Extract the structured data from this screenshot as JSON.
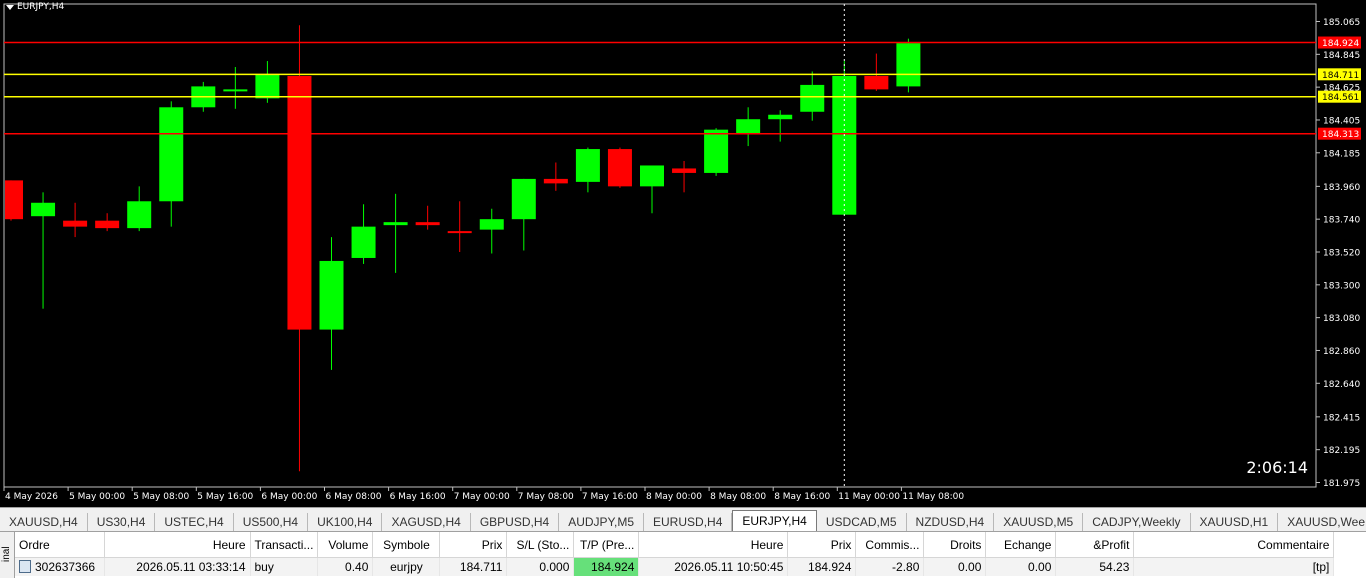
{
  "chart": {
    "symbol_label": "EURJPY,H4",
    "timer": "2:06:14",
    "y_axis_range": [
      181.975,
      185.065
    ],
    "x_labels": [
      "4 May 2026",
      "5 May 00:00",
      "5 May 08:00",
      "5 May 16:00",
      "6 May 00:00",
      "6 May 08:00",
      "6 May 16:00",
      "7 May 00:00",
      "7 May 08:00",
      "7 May 16:00",
      "8 May 00:00",
      "8 May 08:00",
      "8 May 16:00",
      "11 May 00:00",
      "11 May 08:00"
    ],
    "y_labels": [
      "185.065",
      "184.845",
      "184.625",
      "184.405",
      "184.185",
      "183.960",
      "183.740",
      "183.520",
      "183.300",
      "183.080",
      "182.860",
      "182.640",
      "182.415",
      "182.195",
      "181.975"
    ],
    "levels": [
      {
        "value": 184.924,
        "label": "184.924",
        "color": "#ff0000"
      },
      {
        "value": 184.711,
        "label": "184.711",
        "color": "#ffff00"
      },
      {
        "value": 184.561,
        "label": "184.561",
        "color": "#ffff00"
      },
      {
        "value": 184.313,
        "label": "184.313",
        "color": "#ff0000"
      }
    ],
    "bull_color": "#00ff00",
    "bear_color": "#ff0000",
    "candles": [
      {
        "o": 184.0,
        "h": 184.0,
        "l": 183.73,
        "c": 183.74
      },
      {
        "o": 183.76,
        "h": 183.92,
        "l": 183.14,
        "c": 183.85
      },
      {
        "o": 183.73,
        "h": 183.85,
        "l": 183.62,
        "c": 183.69
      },
      {
        "o": 183.73,
        "h": 183.78,
        "l": 183.66,
        "c": 183.68
      },
      {
        "o": 183.68,
        "h": 183.96,
        "l": 183.66,
        "c": 183.86
      },
      {
        "o": 183.86,
        "h": 184.53,
        "l": 183.69,
        "c": 184.49
      },
      {
        "o": 184.49,
        "h": 184.66,
        "l": 184.46,
        "c": 184.63
      },
      {
        "o": 184.6,
        "h": 184.76,
        "l": 184.48,
        "c": 184.61
      },
      {
        "o": 184.55,
        "h": 184.8,
        "l": 184.52,
        "c": 184.71
      },
      {
        "o": 184.7,
        "h": 185.04,
        "l": 182.05,
        "c": 183.0
      },
      {
        "o": 183.0,
        "h": 183.62,
        "l": 182.73,
        "c": 183.46
      },
      {
        "o": 183.48,
        "h": 183.84,
        "l": 183.44,
        "c": 183.69
      },
      {
        "o": 183.7,
        "h": 183.91,
        "l": 183.38,
        "c": 183.72
      },
      {
        "o": 183.72,
        "h": 183.83,
        "l": 183.67,
        "c": 183.7
      },
      {
        "o": 183.66,
        "h": 183.86,
        "l": 183.52,
        "c": 183.65
      },
      {
        "o": 183.67,
        "h": 183.81,
        "l": 183.51,
        "c": 183.74
      },
      {
        "o": 183.74,
        "h": 184.01,
        "l": 183.53,
        "c": 184.01
      },
      {
        "o": 184.01,
        "h": 184.12,
        "l": 183.93,
        "c": 183.98
      },
      {
        "o": 183.99,
        "h": 184.22,
        "l": 183.92,
        "c": 184.21
      },
      {
        "o": 184.21,
        "h": 184.22,
        "l": 183.95,
        "c": 183.96
      },
      {
        "o": 183.96,
        "h": 184.1,
        "l": 183.78,
        "c": 184.1
      },
      {
        "o": 184.08,
        "h": 184.13,
        "l": 183.92,
        "c": 184.05
      },
      {
        "o": 184.05,
        "h": 184.35,
        "l": 184.03,
        "c": 184.34
      },
      {
        "o": 184.31,
        "h": 184.49,
        "l": 184.23,
        "c": 184.41
      },
      {
        "o": 184.41,
        "h": 184.47,
        "l": 184.26,
        "c": 184.44
      },
      {
        "o": 184.46,
        "h": 184.73,
        "l": 184.4,
        "c": 184.64
      },
      {
        "o": 183.77,
        "h": 184.8,
        "l": 183.77,
        "c": 184.7
      },
      {
        "o": 184.7,
        "h": 184.85,
        "l": 184.6,
        "c": 184.61
      },
      {
        "o": 184.63,
        "h": 184.95,
        "l": 184.59,
        "c": 184.92
      }
    ]
  },
  "tabs": [
    "XAUUSD,H4",
    "US30,H4",
    "USTEC,H4",
    "US500,H4",
    "UK100,H4",
    "XAGUSD,H4",
    "GBPUSD,H4",
    "AUDJPY,M5",
    "EURUSD,H4",
    "EURJPY,H4",
    "USDCAD,M5",
    "NZDUSD,H4",
    "XAUUSD,M5",
    "CADJPY,Weekly",
    "XAUUSD,H1",
    "XAUUSD,Wee"
  ],
  "active_tab": "EURJPY,H4",
  "terminal": {
    "side_label": "inal",
    "headers": [
      "Ordre",
      "Heure",
      "Transacti...",
      "Volume",
      "Symbole",
      "Prix",
      "S/L (Sto...",
      "T/P (Pre...",
      "Heure",
      "Prix",
      "Commis...",
      "Droits",
      "Echange",
      "&Profit",
      "Commentaire"
    ],
    "row": [
      "302637366",
      "2026.05.11 03:33:14",
      "buy",
      "0.40",
      "eurjpy",
      "184.711",
      "0.000",
      "184.924",
      "2026.05.11 10:50:45",
      "184.924",
      "-2.80",
      "0.00",
      "0.00",
      "54.23",
      "[tp]"
    ]
  }
}
